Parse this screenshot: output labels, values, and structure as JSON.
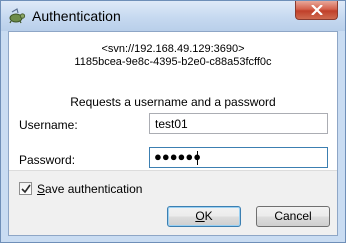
{
  "window": {
    "title": "Authentication",
    "close_label": "Close"
  },
  "realm": {
    "url": "<svn://192.168.49.129:3690>",
    "uuid": "1185bcea-9e8c-4395-b2e0-c88a53fcff0c"
  },
  "request_text": "Requests a username and a password",
  "username": {
    "label": "Username:",
    "value": "test01"
  },
  "password": {
    "label": "Password:",
    "masked_value": "●●●●●●"
  },
  "save_auth": {
    "label_first": "S",
    "label_rest": "ave authentication",
    "checked": true
  },
  "buttons": {
    "ok_first": "O",
    "ok_rest": "K",
    "cancel": "Cancel"
  },
  "icons": {
    "app": "tortoisesvn-icon",
    "close": "close-icon",
    "check": "checkmark-icon"
  },
  "colors": {
    "titlebar": "#c6d9f0",
    "close_button": "#c0402a",
    "focus_border": "#3c7fb1"
  }
}
